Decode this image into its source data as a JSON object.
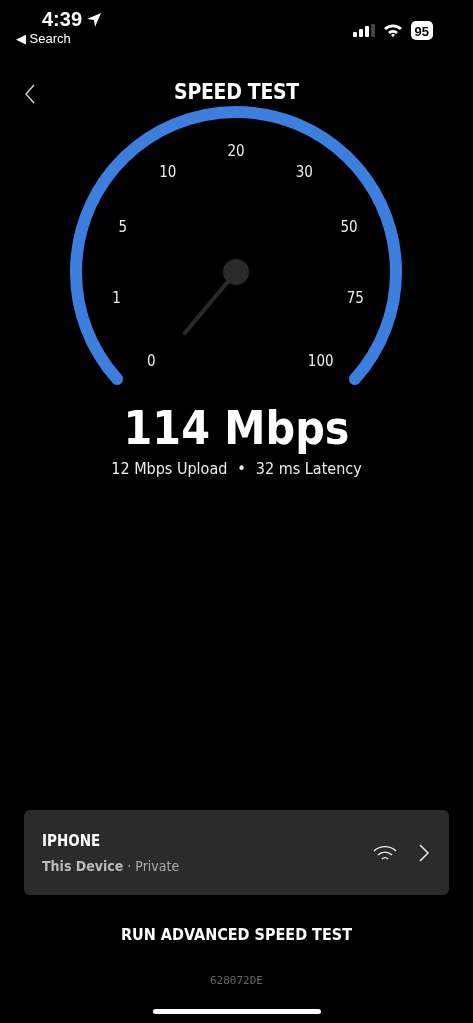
{
  "status_bar": {
    "time": "4:39",
    "back_label": "◀ Search",
    "battery": "95"
  },
  "header": {
    "title": "SPEED TEST"
  },
  "gauge": {
    "ticks": [
      "0",
      "1",
      "5",
      "10",
      "20",
      "30",
      "50",
      "75",
      "100"
    ]
  },
  "result": {
    "speed": "114 Mbps",
    "upload": "12 Mbps Upload",
    "separator": "•",
    "latency": "32 ms Latency"
  },
  "device": {
    "name": "IPHONE",
    "label": "This Device",
    "separator": "·",
    "network": "Private"
  },
  "action": {
    "label": "RUN ADVANCED SPEED TEST"
  },
  "code": "628072DE"
}
